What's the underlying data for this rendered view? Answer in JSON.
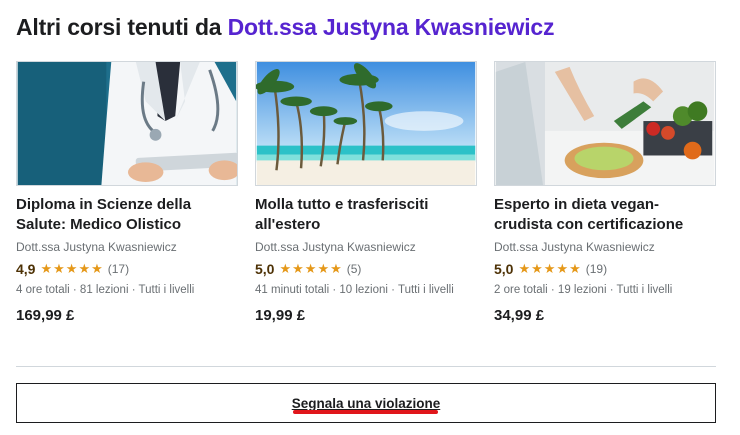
{
  "heading": {
    "prefix": "Altri corsi tenuti da ",
    "instructor_link": "Dott.ssa Justyna Kwasniewicz"
  },
  "courses": [
    {
      "image": "doctor-with-tablet",
      "title": "Diploma in Scienze della Salute: Medico Olistico",
      "instructor": "Dott.ssa Justyna Kwasniewicz",
      "rating": "4,9",
      "stars": 5,
      "reviews": "(17)",
      "meta": "4 ore totali · 81 lezioni · Tutti i livelli",
      "price": "169,99 £"
    },
    {
      "image": "tropical-beach-palms",
      "title": "Molla tutto e trasferisciti all'estero",
      "instructor": "Dott.ssa Justyna Kwasniewicz",
      "rating": "5,0",
      "stars": 5,
      "reviews": "(5)",
      "meta": "41 minuti totali · 10 lezioni · Tutti i livelli",
      "price": "19,99 £"
    },
    {
      "image": "vegetable-spiralizer-kitchen",
      "title": "Esperto in dieta vegan-crudista con certificazione",
      "instructor": "Dott.ssa Justyna Kwasniewicz",
      "rating": "5,0",
      "stars": 5,
      "reviews": "(19)",
      "meta": "2 ore totali · 19 lezioni · Tutti i livelli",
      "price": "34,99 £"
    }
  ],
  "report": {
    "label": "Segnala una violazione"
  },
  "colors": {
    "link": "#5624d0",
    "star": "#e59819",
    "rating_text": "#4d3105",
    "highlight_underline": "#e0161b"
  }
}
